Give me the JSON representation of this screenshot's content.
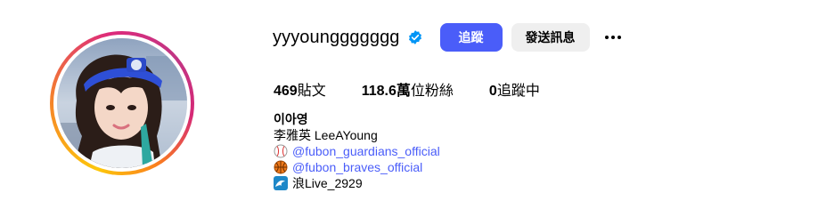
{
  "profile": {
    "username": "yyyounggggggg",
    "verified": true,
    "follow_label": "追蹤",
    "message_label": "發送訊息",
    "more_icon": "more-horizontal-icon"
  },
  "stats": {
    "posts_count": "469",
    "posts_label": "貼文",
    "followers_count": "118.6萬",
    "followers_label": "位粉絲",
    "following_count": "0",
    "following_label": "追蹤中"
  },
  "bio": {
    "display_name": "이아영",
    "line1": "李雅英 LeeAYoung",
    "link1": "@fubon_guardians_official",
    "link2": "@fubon_braves_official",
    "line4": "浪Live_2929"
  },
  "colors": {
    "accent": "#4a5df9",
    "verified": "#0095f6",
    "secondary_button": "#efefef"
  }
}
